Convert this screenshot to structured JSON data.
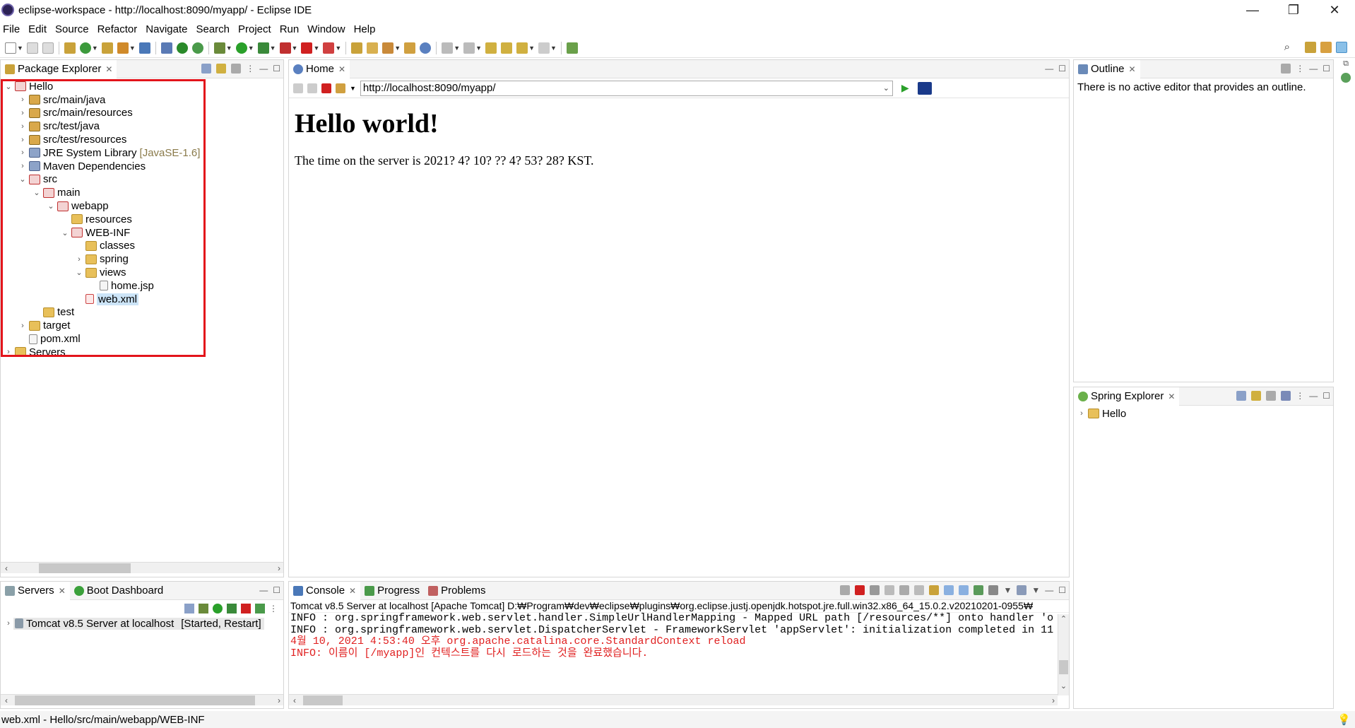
{
  "window": {
    "title": "eclipse-workspace - http://localhost:8090/myapp/ - Eclipse IDE",
    "minimize": "—",
    "maximize": "❐",
    "close": "✕"
  },
  "menu": [
    "File",
    "Edit",
    "Source",
    "Refactor",
    "Navigate",
    "Search",
    "Project",
    "Run",
    "Window",
    "Help"
  ],
  "package_explorer": {
    "tab_label": "Package Explorer",
    "tree": [
      {
        "label": "Hello",
        "depth": 0,
        "twisty": "⌄",
        "icon": "proj"
      },
      {
        "label": "src/main/java",
        "depth": 1,
        "twisty": "›",
        "icon": "pkg"
      },
      {
        "label": "src/main/resources",
        "depth": 1,
        "twisty": "›",
        "icon": "pkg"
      },
      {
        "label": "src/test/java",
        "depth": 1,
        "twisty": "›",
        "icon": "pkg"
      },
      {
        "label": "src/test/resources",
        "depth": 1,
        "twisty": "›",
        "icon": "pkg"
      },
      {
        "label": "JRE System Library",
        "deco": "[JavaSE-1.6]",
        "depth": 1,
        "twisty": "›",
        "icon": "lib"
      },
      {
        "label": "Maven Dependencies",
        "depth": 1,
        "twisty": "›",
        "icon": "lib"
      },
      {
        "label": "src",
        "depth": 1,
        "twisty": "⌄",
        "icon": "proj"
      },
      {
        "label": "main",
        "depth": 2,
        "twisty": "⌄",
        "icon": "proj"
      },
      {
        "label": "webapp",
        "depth": 3,
        "twisty": "⌄",
        "icon": "proj"
      },
      {
        "label": "resources",
        "depth": 4,
        "twisty": "",
        "icon": "folder"
      },
      {
        "label": "WEB-INF",
        "depth": 4,
        "twisty": "⌄",
        "icon": "proj"
      },
      {
        "label": "classes",
        "depth": 5,
        "twisty": "",
        "icon": "folder"
      },
      {
        "label": "spring",
        "depth": 5,
        "twisty": "›",
        "icon": "folder"
      },
      {
        "label": "views",
        "depth": 5,
        "twisty": "⌄",
        "icon": "folder"
      },
      {
        "label": "home.jsp",
        "depth": 6,
        "twisty": "",
        "icon": "file"
      },
      {
        "label": "web.xml",
        "depth": 5,
        "twisty": "",
        "icon": "xml",
        "selected": true
      },
      {
        "label": "test",
        "depth": 2,
        "twisty": "",
        "icon": "folder"
      },
      {
        "label": "target",
        "depth": 1,
        "twisty": "›",
        "icon": "folder"
      },
      {
        "label": "pom.xml",
        "depth": 1,
        "twisty": "",
        "icon": "file"
      },
      {
        "label": "Servers",
        "depth": 0,
        "twisty": "›",
        "icon": "folder"
      }
    ]
  },
  "browser": {
    "tab_label": "Home",
    "url": "http://localhost:8090/myapp/",
    "heading": "Hello world!",
    "body_text": "The time on the server is 2021? 4? 10? ?? 4? 53? 28? KST."
  },
  "outline": {
    "tab_label": "Outline",
    "message": "There is no active editor that provides an outline."
  },
  "spring_explorer": {
    "tab_label": "Spring Explorer",
    "item": "Hello"
  },
  "servers": {
    "tab_label": "Servers",
    "tab2_label": "Boot Dashboard",
    "server": "Tomcat v8.5 Server at localhost",
    "state": "[Started, Restart]"
  },
  "console": {
    "tabs": [
      "Console",
      "Progress",
      "Problems"
    ],
    "header": "Tomcat v8.5 Server at localhost [Apache Tomcat] D:₩Program₩dev₩eclipse₩plugins₩org.eclipse.justj.openjdk.hotspot.jre.full.win32.x86_64_15.0.2.v20210201-0955₩",
    "lines": [
      {
        "text": "INFO : org.springframework.web.servlet.handler.SimpleUrlHandlerMapping - Mapped URL path [/resources/**] onto handler 'o",
        "red": false
      },
      {
        "text": "INFO : org.springframework.web.servlet.DispatcherServlet - FrameworkServlet 'appServlet': initialization completed in 11",
        "red": false
      },
      {
        "text": "4월 10, 2021 4:53:40 오후 org.apache.catalina.core.StandardContext reload",
        "red": true
      },
      {
        "text": "INFO: 이름이 [/myapp]인 컨텍스트를 다시 로드하는 것을 완료했습니다.",
        "red": true
      }
    ]
  },
  "status_bar": {
    "text": "web.xml - Hello/src/main/webapp/WEB-INF"
  },
  "colors": {
    "highlight": "#e3141b",
    "selection": "#cce4f7",
    "console_error": "#e02020"
  }
}
